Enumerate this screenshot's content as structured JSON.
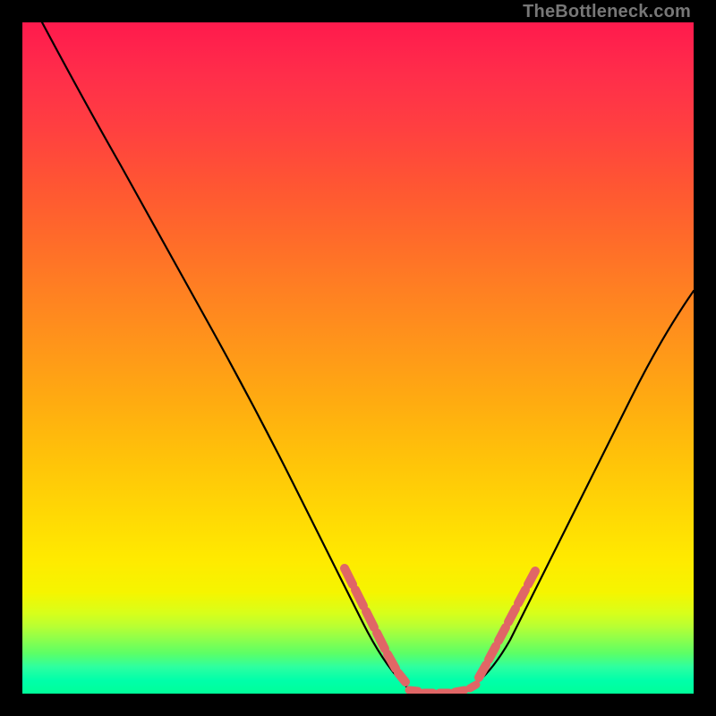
{
  "watermark": "TheBottleneck.com",
  "chart_data": {
    "type": "line",
    "title": "",
    "xlabel": "",
    "ylabel": "",
    "xlim": [
      0,
      1
    ],
    "ylim": [
      0,
      1
    ],
    "grid": false,
    "legend": false,
    "background": "rainbow-gradient-vertical",
    "series": [
      {
        "name": "bottleneck-curve",
        "color": "#000000",
        "x": [
          0.0,
          0.05,
          0.1,
          0.15,
          0.2,
          0.25,
          0.3,
          0.35,
          0.4,
          0.45,
          0.5,
          0.55,
          0.575,
          0.6,
          0.625,
          0.65,
          0.675,
          0.7,
          0.75,
          0.8,
          0.85,
          0.9,
          0.95,
          1.0
        ],
        "y": [
          1.0,
          0.92,
          0.84,
          0.76,
          0.68,
          0.6,
          0.52,
          0.43,
          0.34,
          0.24,
          0.14,
          0.05,
          0.01,
          0.0,
          0.0,
          0.01,
          0.03,
          0.07,
          0.16,
          0.26,
          0.36,
          0.45,
          0.53,
          0.6
        ]
      }
    ],
    "annotations": [
      {
        "name": "left-highlight-segment",
        "type": "thick-line",
        "color": "#e57373",
        "x_range": [
          0.48,
          0.56
        ],
        "y_range": [
          0.18,
          0.03
        ]
      },
      {
        "name": "bottom-highlight-segment",
        "type": "thick-line",
        "color": "#e57373",
        "x_range": [
          0.575,
          0.66
        ],
        "y_range": [
          0.005,
          0.005
        ]
      },
      {
        "name": "right-highlight-segment",
        "type": "thick-line",
        "color": "#e57373",
        "x_range": [
          0.675,
          0.76
        ],
        "y_range": [
          0.03,
          0.18
        ]
      }
    ]
  }
}
